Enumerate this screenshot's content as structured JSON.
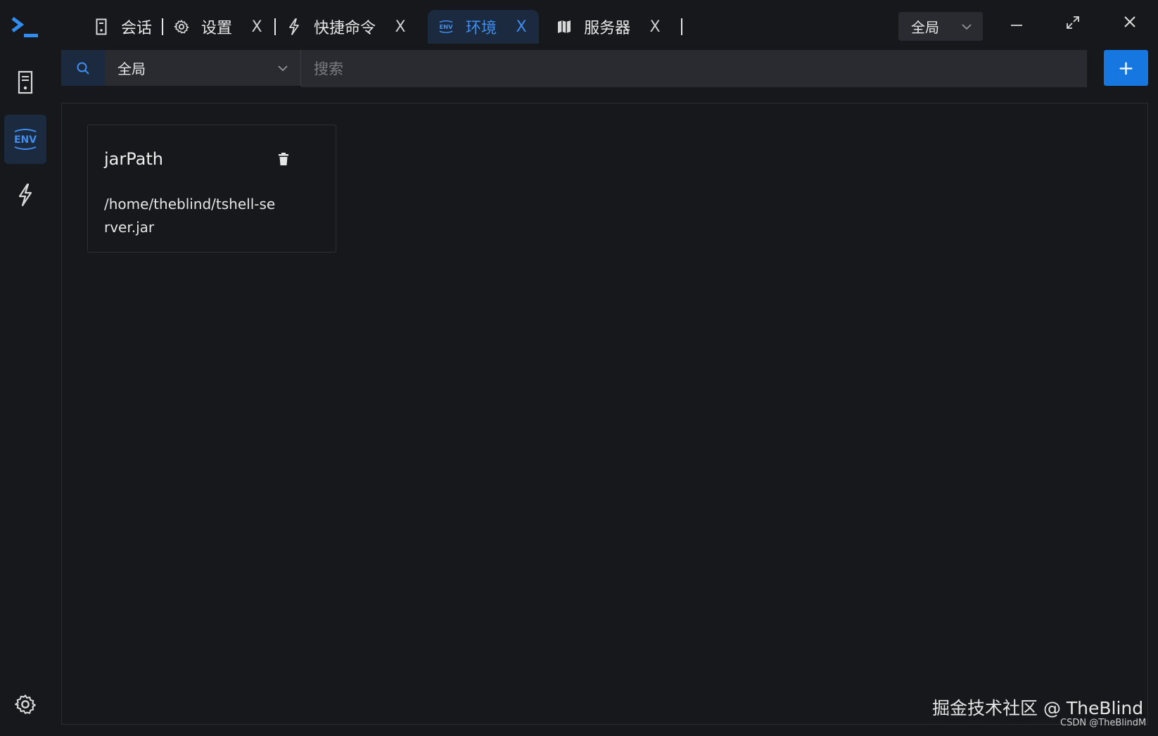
{
  "titlebar": {
    "tabs": [
      {
        "label": "会话",
        "icon": "server-icon",
        "closable": false
      },
      {
        "label": "设置",
        "icon": "gear-icon",
        "closable": true
      },
      {
        "label": "快捷命令",
        "icon": "lightning-icon",
        "closable": true
      },
      {
        "label": "环境",
        "icon": "env-icon",
        "closable": true,
        "active": true
      },
      {
        "label": "服务器",
        "icon": "map-icon",
        "closable": true
      }
    ],
    "close_glyph": "X",
    "scope_selected": "全局"
  },
  "rail": {
    "items": [
      {
        "name": "sessions",
        "icon": "server-icon"
      },
      {
        "name": "environment",
        "icon": "env-icon",
        "active": true
      },
      {
        "name": "quick-commands",
        "icon": "lightning-icon"
      }
    ],
    "bottom": {
      "name": "settings",
      "icon": "gear-icon"
    }
  },
  "searchbar": {
    "scope_selected": "全局",
    "placeholder": "搜索",
    "add_label": "+"
  },
  "environments": [
    {
      "name": "jarPath",
      "value": "/home/theblind/tshell-server.jar"
    }
  ],
  "watermark": {
    "main": "掘金技术社区 @ TheBlind",
    "sub": "CSDN @TheBlindM"
  },
  "colors": {
    "background": "#17181c",
    "accent": "#1677e0",
    "active_tab_bg": "#1b2a3f",
    "active_text": "#3d8ef0"
  }
}
